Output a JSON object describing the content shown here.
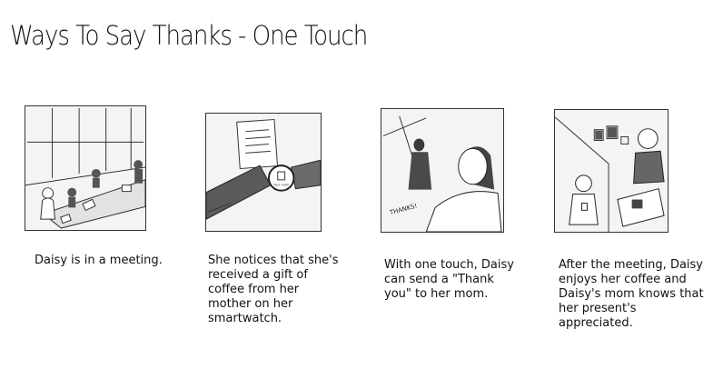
{
  "page": {
    "title": "Ways To Say Thanks - One Touch"
  },
  "storyboard": {
    "panels": [
      {
        "caption": "Daisy is in a meeting.",
        "image": "meeting-sketch"
      },
      {
        "caption": "She notices that she's received a gift of coffee from her mother on her smartwatch.",
        "image": "smartwatch-sketch"
      },
      {
        "caption": "With one touch, Daisy can send a \"Thank you\" to her mom.",
        "image": "thanks-sketch"
      },
      {
        "caption": "After the meeting, Daisy enjoys her coffee and Daisy's mom knows that her present's appreciated.",
        "image": "coffee-sketch"
      }
    ],
    "sketch_text": {
      "watch_label": "Your mom",
      "thanks_label": "THANKS!"
    }
  }
}
